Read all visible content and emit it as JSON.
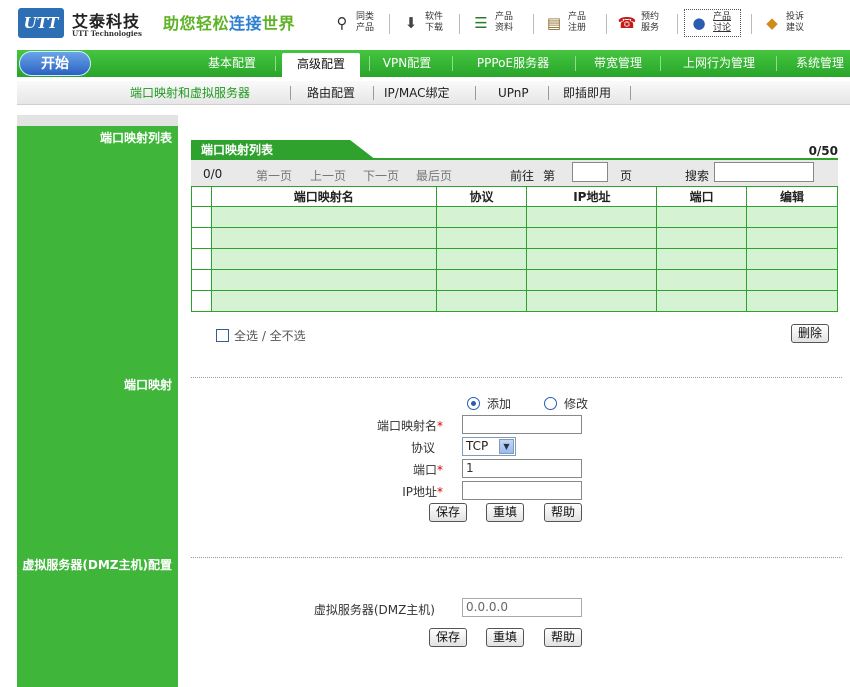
{
  "header": {
    "logo_text": "UTT",
    "brand_cn": "艾泰科技",
    "brand_en": "UTT Technologies",
    "slogan": {
      "part1": "助您轻松",
      "part2": "连接",
      "part3": "世界"
    },
    "links": [
      {
        "l1": "同类",
        "l2": "产品",
        "icon": "search-icon"
      },
      {
        "l1": "软件",
        "l2": "下载",
        "icon": "download-icon"
      },
      {
        "l1": "产品",
        "l2": "资料",
        "icon": "books-icon"
      },
      {
        "l1": "产品",
        "l2": "注册",
        "icon": "register-icon"
      },
      {
        "l1": "预约",
        "l2": "服务",
        "icon": "phone-icon"
      },
      {
        "l1": "产品",
        "l2": "讨论",
        "icon": "users-icon"
      },
      {
        "l1": "投诉",
        "l2": "建议",
        "icon": "suggest-icon"
      }
    ]
  },
  "nav": {
    "start": "开始",
    "tabs": [
      "基本配置",
      "高级配置",
      "VPN配置",
      "PPPoE服务器",
      "带宽管理",
      "上网行为管理",
      "系统管理"
    ]
  },
  "subnav": [
    "端口映射和虚拟服务器",
    "路由配置",
    "IP/MAC绑定",
    "UPnP",
    "即插即用"
  ],
  "sections": {
    "list": "端口映射列表",
    "mapping": "端口映射",
    "dmz": "虚拟服务器(DMZ主机)配置"
  },
  "table": {
    "title": "端口映射列表",
    "count": "0/50",
    "pager": {
      "status": "0/0",
      "first": "第一页",
      "prev": "上一页",
      "next": "下一页",
      "last": "最后页",
      "goto": "前往",
      "page_prefix": "第",
      "page_suffix": "页",
      "search": "搜索"
    },
    "columns": [
      "端口映射名",
      "协议",
      "IP地址",
      "端口",
      "编辑"
    ],
    "row_count": 5,
    "select_all": "全选 / 全不选",
    "delete": "删除"
  },
  "form": {
    "radio_add": "添加",
    "radio_modify": "修改",
    "name_label": "端口映射名",
    "protocol_label": "协议",
    "protocol_value": "TCP",
    "port_label": "端口",
    "port_value": "1",
    "ip_label": "IP地址",
    "required_mark": "*",
    "save": "保存",
    "reset": "重填",
    "help": "帮助"
  },
  "dmz": {
    "label": "虚拟服务器(DMZ主机)",
    "value": "0.0.0.0",
    "save": "保存",
    "reset": "重填",
    "help": "帮助"
  }
}
